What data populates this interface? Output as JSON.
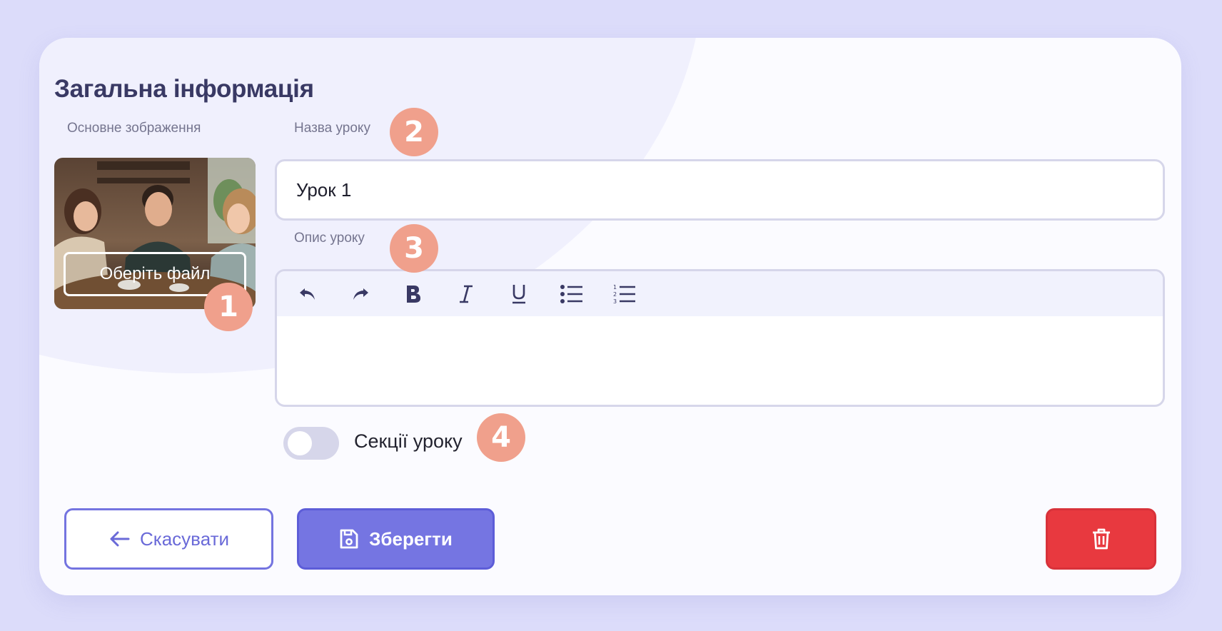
{
  "section": {
    "title": "Загальна інформація"
  },
  "image": {
    "label": "Основне зображення",
    "choose_file": "Оберіть файл"
  },
  "lesson_name": {
    "label": "Назва уроку",
    "value": "Урок 1"
  },
  "lesson_description": {
    "label": "Опис уроку",
    "toolbar": [
      "undo-icon",
      "redo-icon",
      "bold-icon",
      "italic-icon",
      "underline-icon",
      "bullet-list-icon",
      "numbered-list-icon"
    ]
  },
  "sections_toggle": {
    "label": "Секції уроку",
    "on": false
  },
  "badges": [
    "1",
    "2",
    "3",
    "4"
  ],
  "actions": {
    "cancel": "Скасувати",
    "save": "Зберегти"
  },
  "colors": {
    "accent": "#7575e2",
    "danger": "#e8393f",
    "badge": "#f0a08c",
    "heading": "#393964"
  }
}
